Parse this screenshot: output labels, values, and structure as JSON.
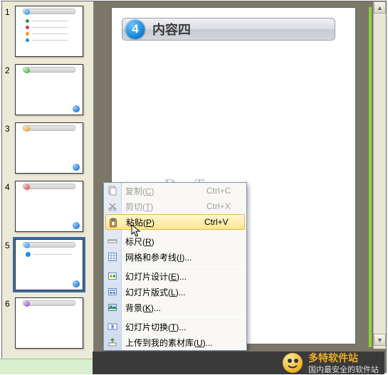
{
  "slide_title": {
    "number": "4",
    "text": "内容四"
  },
  "thumbnails": [
    {
      "num": "1",
      "circle_color": "#1e90e0",
      "bullets": [
        "#2aa02a",
        "#d13c3c",
        "#e0a024",
        "#1e90e0"
      ]
    },
    {
      "num": "2",
      "circle_color": "#2aa02a",
      "bullets": []
    },
    {
      "num": "3",
      "circle_color": "#e09024",
      "bullets": []
    },
    {
      "num": "4",
      "circle_color": "#d13c3c",
      "bullets": []
    },
    {
      "num": "5",
      "circle_color": "#1e90e0",
      "bullets": []
    },
    {
      "num": "6",
      "circle_color": "#8040c0",
      "bullets": []
    }
  ],
  "selected_thumb": 5,
  "context_menu": {
    "highlight_index": 2,
    "items": [
      {
        "icon": "copy-icon",
        "label": "复制(C)",
        "shortcut": "Ctrl+C",
        "disabled": true
      },
      {
        "icon": "cut-icon",
        "label": "剪切(T)",
        "shortcut": "Ctrl+X",
        "disabled": true
      },
      {
        "icon": "paste-icon",
        "label": "粘贴(P)",
        "shortcut": "Ctrl+V",
        "disabled": false
      },
      {
        "sep": true
      },
      {
        "icon": "ruler-icon",
        "label": "标尺(R)",
        "shortcut": "",
        "disabled": false
      },
      {
        "icon": "grid-icon",
        "label": "网格和参考线(I)...",
        "shortcut": "",
        "disabled": false
      },
      {
        "sep": true
      },
      {
        "icon": "design-icon",
        "label": "幻灯片设计(E)...",
        "shortcut": "",
        "disabled": false
      },
      {
        "icon": "layout-icon",
        "label": "幻灯片版式(L)...",
        "shortcut": "",
        "disabled": false
      },
      {
        "icon": "background-icon",
        "label": "背景(K)...",
        "shortcut": "",
        "disabled": false
      },
      {
        "sep": true
      },
      {
        "icon": "transition-icon",
        "label": "幻灯片切换(T)...",
        "shortcut": "",
        "disabled": false
      },
      {
        "icon": "upload-icon",
        "label": "上传到我的素材库(U)...",
        "shortcut": "",
        "disabled": false
      }
    ]
  },
  "watermark": "www.DuoTe.com",
  "footer": {
    "brand": "多特软件站",
    "tagline": "国内最安全的软件站"
  }
}
